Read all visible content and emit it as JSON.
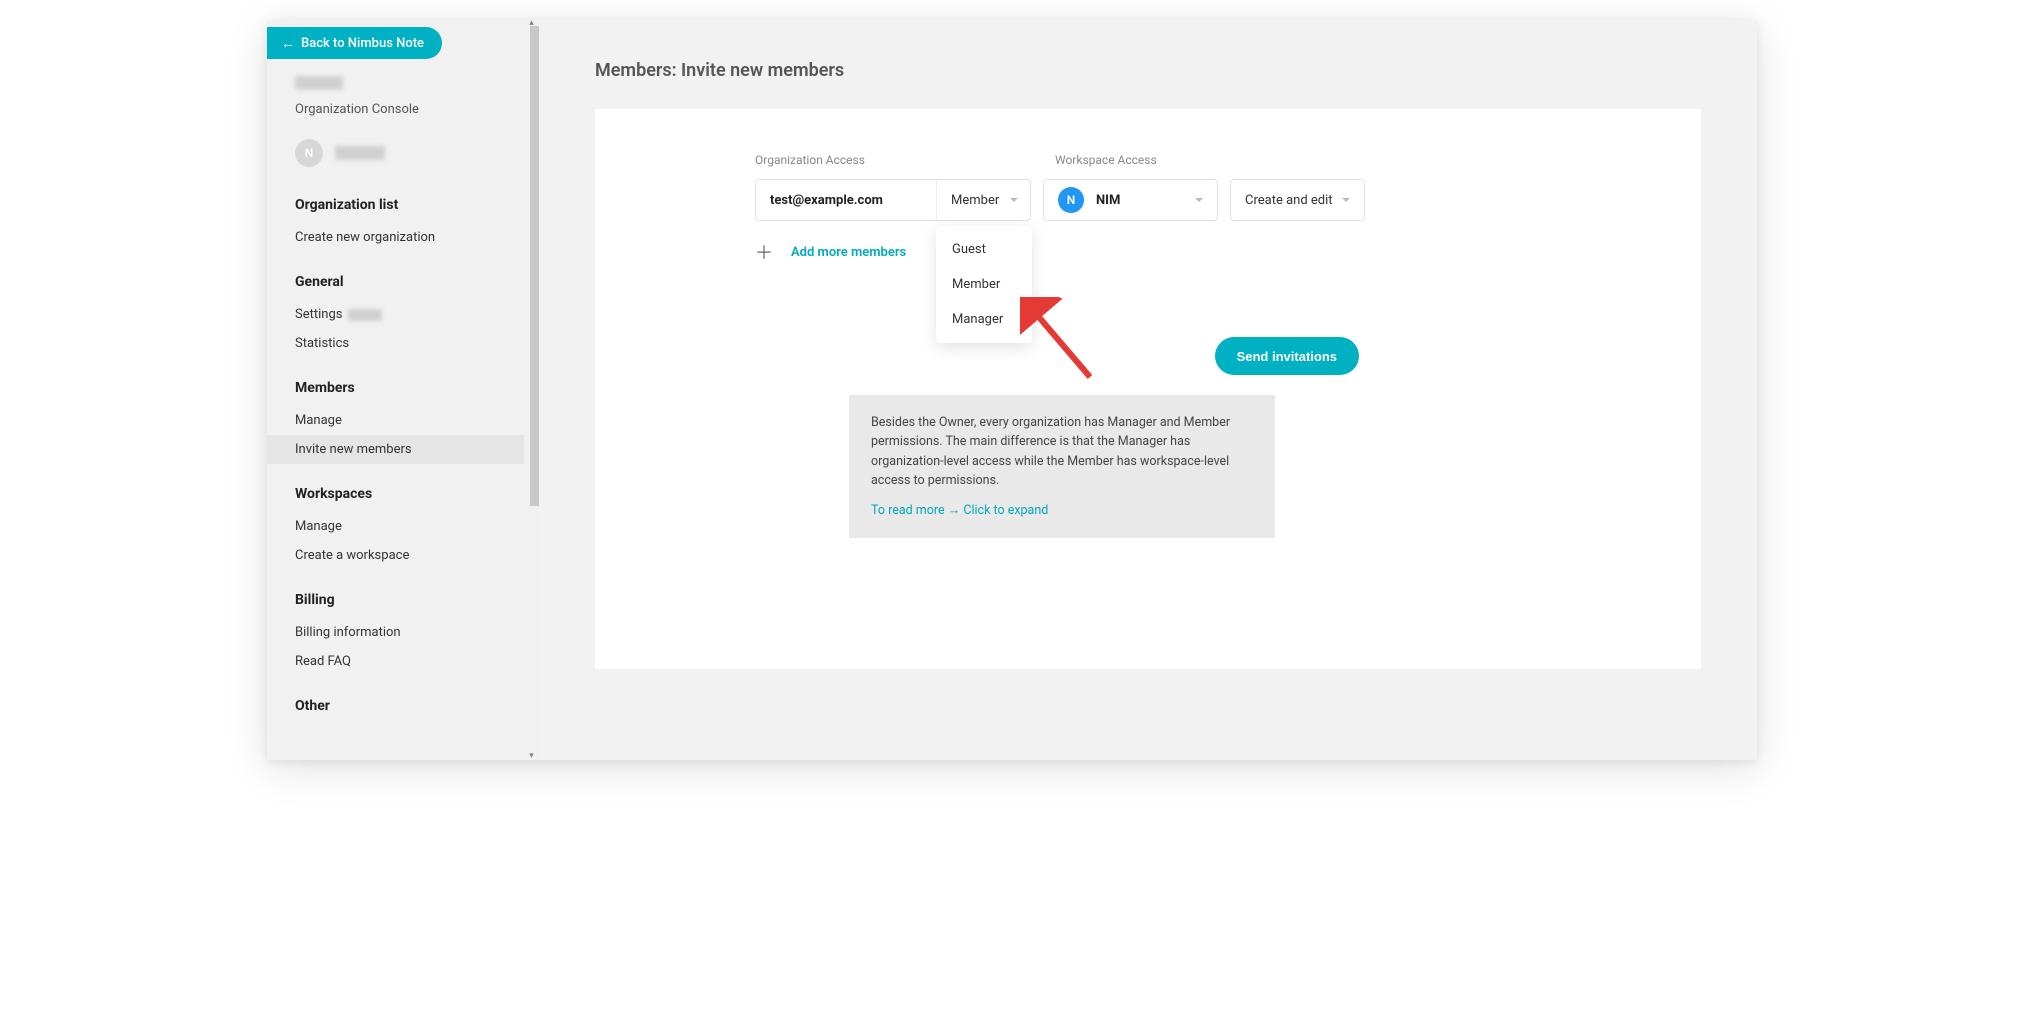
{
  "header": {
    "back_label": "Back to Nimbus Note"
  },
  "sidebar": {
    "org_console": "Organization Console",
    "avatar_letter": "N",
    "sections": {
      "org_list_title": "Organization list",
      "org_list_items": [
        "Create new organization"
      ],
      "general_title": "General",
      "general_items": [
        "Settings",
        "Statistics"
      ],
      "members_title": "Members",
      "members_items": [
        "Manage",
        "Invite new members"
      ],
      "workspaces_title": "Workspaces",
      "workspaces_items": [
        "Manage",
        "Create a workspace"
      ],
      "billing_title": "Billing",
      "billing_items": [
        "Billing information",
        "Read FAQ"
      ],
      "other_title": "Other"
    }
  },
  "main": {
    "page_title": "Members: Invite new members",
    "org_access_label": "Organization Access",
    "ws_access_label": "Workspace Access",
    "email_value": "test@example.com",
    "role_selected": "Member",
    "role_options": [
      "Guest",
      "Member",
      "Manager"
    ],
    "ws_badge_letter": "N",
    "ws_name": "NIM",
    "permission_selected": "Create and edit",
    "add_more_label": "Add more members",
    "send_label": "Send invitations",
    "info_text": "Besides the Owner, every organization has Manager and Member permissions. The main difference is that the Manager has organization-level access while the Member has workspace-level access to permissions.",
    "info_link": "To read more → Click to expand"
  }
}
